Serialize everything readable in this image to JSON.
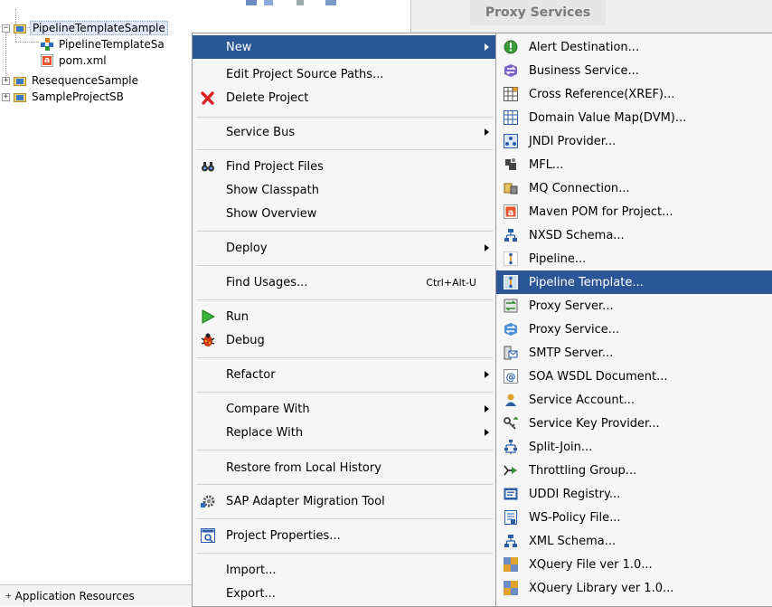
{
  "tree": {
    "nodes": [
      {
        "label": "PipelineTemplateSample",
        "icon": "folder-icon"
      },
      {
        "label": "PipelineTemplateSa",
        "icon": "pipeline-icon"
      },
      {
        "label": "pom.xml",
        "icon": "maven-pom-icon"
      },
      {
        "label": "ResequenceSample",
        "icon": "folder-icon"
      },
      {
        "label": "SampleProjectSB",
        "icon": "folder-icon"
      }
    ],
    "footer": "Application Resources"
  },
  "right_panel": {
    "tab": "Proxy Services"
  },
  "context_menu": {
    "items": [
      {
        "label": "New",
        "icon": "",
        "submenu": true
      },
      {
        "label": "Edit Project Source Paths...",
        "icon": ""
      },
      {
        "label": "Delete Project",
        "icon": "delete-icon"
      },
      {
        "label": "Service Bus",
        "icon": "",
        "submenu": true
      },
      {
        "label": "Find Project Files",
        "icon": "binoculars-icon"
      },
      {
        "label": "Show Classpath",
        "icon": ""
      },
      {
        "label": "Show Overview",
        "icon": ""
      },
      {
        "label": "Deploy",
        "icon": "",
        "submenu": true
      },
      {
        "label": "Find Usages...",
        "icon": "",
        "shortcut": "Ctrl+Alt-U"
      },
      {
        "label": "Run",
        "icon": "run-icon"
      },
      {
        "label": "Debug",
        "icon": "debug-icon"
      },
      {
        "label": "Refactor",
        "icon": "",
        "submenu": true
      },
      {
        "label": "Compare With",
        "icon": "",
        "submenu": true
      },
      {
        "label": "Replace With",
        "icon": "",
        "submenu": true
      },
      {
        "label": "Restore from Local History",
        "icon": ""
      },
      {
        "label": "SAP Adapter Migration Tool",
        "icon": "gear-icon"
      },
      {
        "label": "Project Properties...",
        "icon": "properties-icon"
      },
      {
        "label": "Import...",
        "icon": ""
      },
      {
        "label": "Export...",
        "icon": ""
      }
    ]
  },
  "submenu": {
    "items": [
      {
        "label": "Alert Destination...",
        "icon": "alert-icon"
      },
      {
        "label": "Business Service...",
        "icon": "business-service-icon"
      },
      {
        "label": "Cross Reference(XREF)...",
        "icon": "xref-icon"
      },
      {
        "label": "Domain Value Map(DVM)...",
        "icon": "dvm-icon"
      },
      {
        "label": "JNDI Provider...",
        "icon": "jndi-icon"
      },
      {
        "label": "MFL...",
        "icon": "mfl-icon"
      },
      {
        "label": "MQ Connection...",
        "icon": "mq-icon"
      },
      {
        "label": "Maven POM for Project...",
        "icon": "maven-pom-icon"
      },
      {
        "label": "NXSD Schema...",
        "icon": "nxsd-icon"
      },
      {
        "label": "Pipeline...",
        "icon": "pipeline-icon"
      },
      {
        "label": "Pipeline Template...",
        "icon": "pipeline-template-icon"
      },
      {
        "label": "Proxy Server...",
        "icon": "proxy-server-icon"
      },
      {
        "label": "Proxy Service...",
        "icon": "proxy-service-icon"
      },
      {
        "label": "SMTP Server...",
        "icon": "smtp-icon"
      },
      {
        "label": "SOA WSDL Document...",
        "icon": "wsdl-icon"
      },
      {
        "label": "Service Account...",
        "icon": "account-icon"
      },
      {
        "label": "Service Key Provider...",
        "icon": "key-icon"
      },
      {
        "label": "Split-Join...",
        "icon": "split-join-icon"
      },
      {
        "label": "Throttling Group...",
        "icon": "throttling-icon"
      },
      {
        "label": "UDDI Registry...",
        "icon": "uddi-icon"
      },
      {
        "label": "WS-Policy File...",
        "icon": "policy-icon"
      },
      {
        "label": "XML Schema...",
        "icon": "xml-schema-icon"
      },
      {
        "label": "XQuery File ver 1.0...",
        "icon": "xquery-icon"
      },
      {
        "label": "XQuery Library ver 1.0...",
        "icon": "xquery-icon"
      }
    ]
  },
  "colors": {
    "highlight": "#2b5797",
    "menu_bg": "#f6f6f6"
  }
}
